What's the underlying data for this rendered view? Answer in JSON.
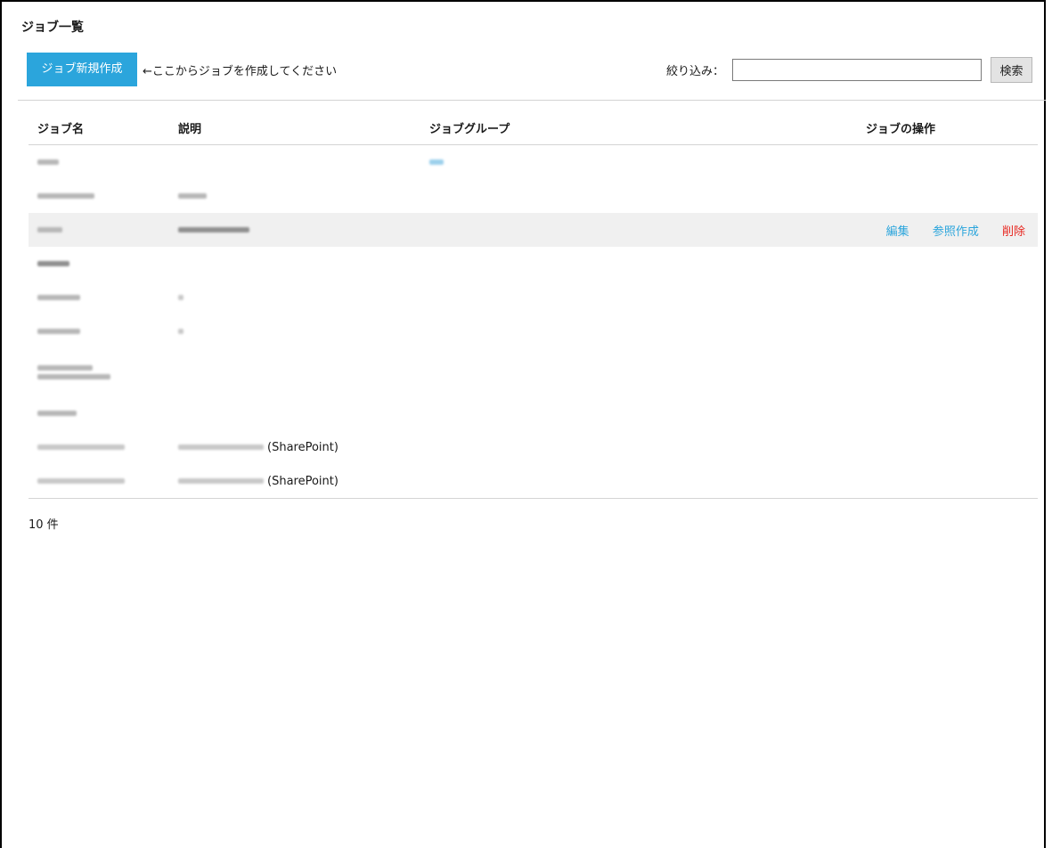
{
  "page": {
    "title": "ジョブ一覧"
  },
  "toolbar": {
    "new_job_label": "ジョブ新規作成",
    "hint": "←ここからジョブを作成してください",
    "filter_label": "絞り込み：",
    "filter_value": "",
    "search_label": "検索"
  },
  "table": {
    "columns": [
      "ジョブ名",
      "説明",
      "ジョブグループ",
      "ジョブの操作"
    ],
    "rows": [
      {
        "name": "[blurred]",
        "description": "",
        "group": "[blurred]"
      },
      {
        "name": "[blurred]",
        "description": "[blurred]",
        "group": ""
      },
      {
        "name": "[blurred]",
        "description": "[blurred]",
        "group": "",
        "highlighted": true
      },
      {
        "name": "[blurred]",
        "description": "",
        "group": ""
      },
      {
        "name": "[blurred]",
        "description": "[blurred]",
        "group": ""
      },
      {
        "name": "[blurred]",
        "description": "[blurred]",
        "group": ""
      },
      {
        "name": "[blurred]",
        "description": "",
        "group": ""
      },
      {
        "name": "[blurred]",
        "description": "",
        "group": ""
      },
      {
        "name": "[blurred]",
        "description": "[blurred] (SharePoint)",
        "group": ""
      },
      {
        "name": "[blurred]",
        "description": "[blurred] (SharePoint)",
        "group": ""
      }
    ],
    "row_actions": {
      "edit": "編集",
      "copy": "参照作成",
      "delete": "削除"
    },
    "sharepoint_suffix": "(SharePoint)"
  },
  "footer": {
    "count": "10 件"
  },
  "colors": {
    "accent": "#2ba5dc",
    "danger": "#e8261f",
    "row_highlight": "#f0f0f0"
  }
}
